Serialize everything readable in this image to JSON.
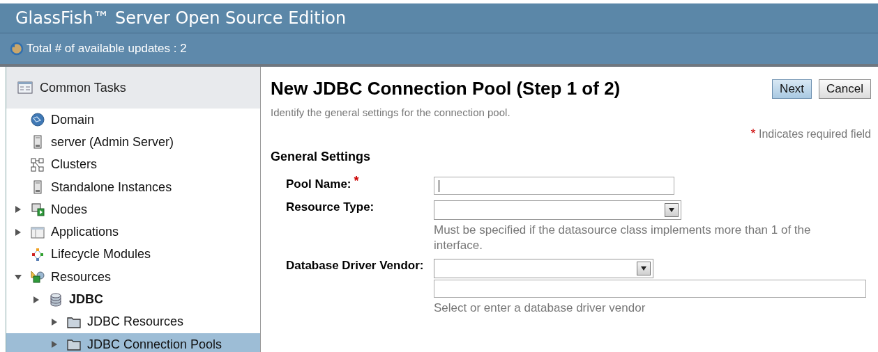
{
  "header": {
    "title": "GlassFish™ Server Open Source Edition",
    "updates": "Total # of available updates : 2"
  },
  "sidebar": {
    "title": "Common Tasks",
    "items": [
      {
        "label": "Domain",
        "kind": "globe",
        "selected": false
      },
      {
        "label": "server (Admin Server)",
        "kind": "server",
        "selected": false
      },
      {
        "label": "Clusters",
        "kind": "cluster",
        "selected": false
      },
      {
        "label": "Standalone Instances",
        "kind": "server",
        "selected": false
      },
      {
        "label": "Nodes",
        "kind": "nodes",
        "expanded": false,
        "selected": false
      },
      {
        "label": "Applications",
        "kind": "app",
        "expanded": false,
        "selected": false
      },
      {
        "label": "Lifecycle Modules",
        "kind": "lifecycle",
        "selected": false
      },
      {
        "label": "Resources",
        "kind": "resources",
        "expanded": true,
        "selected": false,
        "children": [
          {
            "label": "JDBC",
            "kind": "database",
            "expanded": false,
            "selected": false,
            "children": [
              {
                "label": "JDBC Resources",
                "kind": "folder",
                "expanded": false,
                "selected": false
              },
              {
                "label": "JDBC Connection Pools",
                "kind": "folder",
                "expanded": false,
                "selected": true
              }
            ]
          }
        ]
      }
    ]
  },
  "page": {
    "title": "New JDBC Connection Pool (Step 1 of 2)",
    "buttons": [
      {
        "label": "Next",
        "primary": true
      },
      {
        "label": "Cancel",
        "primary": false
      }
    ],
    "description": "Identify the general settings for the connection pool.",
    "required_mark": "*",
    "required_note": "Indicates required field",
    "section": "General Settings",
    "fields": [
      {
        "label": "Pool Name:",
        "kind": "text",
        "required": true
      },
      {
        "label": "Resource Type:",
        "kind": "select",
        "required": false,
        "help": "Must be specified if the datasource class implements more than 1 of the interface."
      },
      {
        "label": "Database Driver Vendor:",
        "kind": "combo",
        "required": false,
        "help": "Select or enter a database driver vendor"
      }
    ]
  }
}
